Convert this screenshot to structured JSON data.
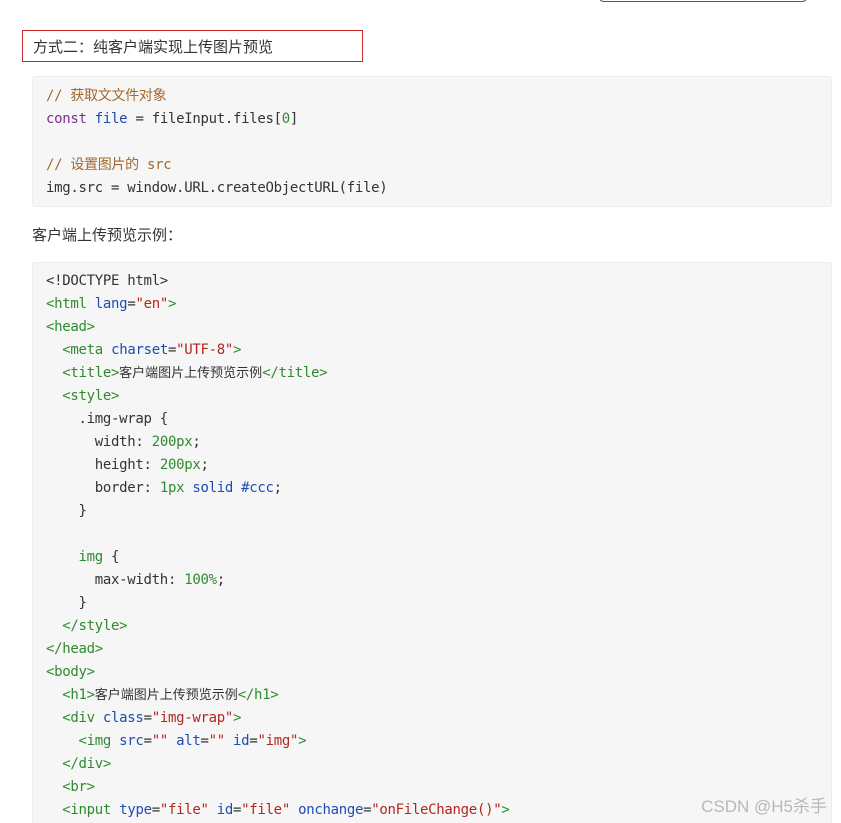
{
  "heading": "方式二：纯客户端实现上传图片预览",
  "code1": {
    "comment1": "// 获取文文件对象",
    "line2_kw": "const",
    "line2_var": "file",
    "line2_rest": " = fileInput.files[",
    "line2_num": "0",
    "line2_end": "]",
    "comment2": "// 设置图片的 src",
    "line5": "img.src = window.URL.createObjectURL(file)"
  },
  "paragraph": "客户端上传预览示例：",
  "code2": {
    "doctype": "<!DOCTYPE html>",
    "html_open_tag": "<html",
    "html_attr": "lang",
    "html_eq": "=",
    "html_val": "\"en\"",
    "html_close": ">",
    "head_open": "<head>",
    "meta_tag": "<meta",
    "meta_attr": "charset",
    "meta_eq": "=",
    "meta_val": "\"UTF-8\"",
    "meta_close": ">",
    "title_open": "<title>",
    "title_text": "客户端图片上传预览示例",
    "title_close": "</title>",
    "style_open": "<style>",
    "selector1": ".img-wrap {",
    "width_prop": "width: ",
    "width_val": "200px",
    "height_prop": "height: ",
    "height_val": "200px",
    "border_prop": "border: ",
    "border_num": "1px",
    "border_solid": "solid",
    "border_color": "#ccc",
    "semicolon": ";",
    "close_brace": "}",
    "selector2_name": "img",
    "selector2_brace": " {",
    "maxw_prop": "max-width: ",
    "maxw_val": "100%",
    "style_close": "</style>",
    "head_close": "</head>",
    "body_open": "<body>",
    "h1_open": "<h1>",
    "h1_text": "客户端图片上传预览示例",
    "h1_close": "</h1>",
    "div_tag": "<div",
    "div_attr": "class",
    "div_eq": "=",
    "div_val": "\"img-wrap\"",
    "div_close": ">",
    "img_tag": "<img",
    "img_src_attr": "src",
    "img_src_val": "\"\"",
    "img_alt_attr": "alt",
    "img_alt_val": "\"\"",
    "img_id_attr": "id",
    "img_id_val": "\"img\"",
    "eq": "=",
    "gt": ">",
    "div_end": "</div>",
    "br": "<br>",
    "input_tag": "<input",
    "input_type_attr": "type",
    "input_type_val": "\"file\"",
    "input_id_attr": "id",
    "input_id_val": "\"file\"",
    "input_onchange_attr": "onchange",
    "input_onchange_val": "\"onFileChange()\""
  },
  "watermark": "CSDN @H5杀手",
  "colors": {
    "heading_border": "#cc2a2a",
    "code_bg": "#f6f6f6",
    "comment": "#a5682a",
    "keyword": "#7f2d8e",
    "tag": "#2f8a2f",
    "attr": "#1f4cb3",
    "string": "#b3261e"
  }
}
